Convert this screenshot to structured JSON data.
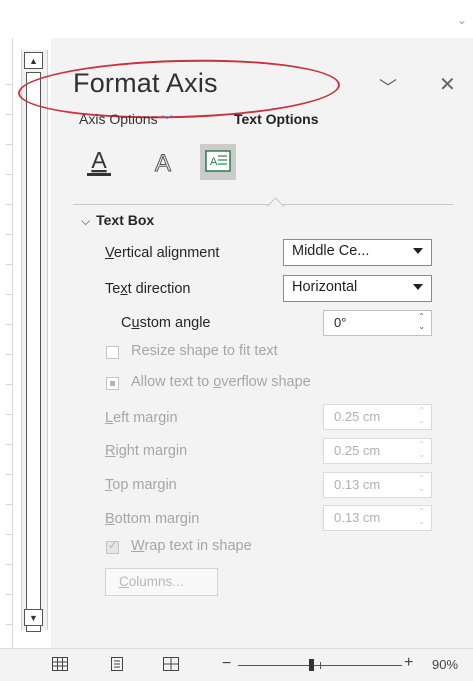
{
  "pane": {
    "title": "Format Axis",
    "collapse_icon": "chevron-down-icon",
    "close_icon": "close-icon",
    "tabs": [
      {
        "label": "Axis Options",
        "selected": false,
        "has_dropdown": true
      },
      {
        "label": "Text Options",
        "selected": true
      }
    ],
    "icon_tabs": [
      {
        "icon": "text-fill-outline-icon",
        "selected": false
      },
      {
        "icon": "text-effects-icon",
        "selected": false
      },
      {
        "icon": "textbox-icon",
        "selected": true
      }
    ],
    "highlight_color": "#c8343c"
  },
  "section": {
    "label": "Text Box",
    "expanded": true
  },
  "fields": {
    "vertical_alignment": {
      "label": "Vertical alignment",
      "value": "Middle Ce..."
    },
    "text_direction": {
      "label": "Text direction",
      "value": "Horizontal"
    },
    "custom_angle": {
      "label": "Custom angle",
      "value": "0°"
    }
  },
  "checkboxes": {
    "resize_shape": {
      "label": "Resize shape to fit text",
      "state": "unchecked",
      "enabled": false
    },
    "allow_overflow": {
      "label": "Allow text to overflow shape",
      "state": "indeterminate",
      "enabled": false
    },
    "wrap_text": {
      "label": "Wrap text in shape",
      "state": "checked",
      "enabled": false
    }
  },
  "margins": {
    "left": {
      "label": "Left margin",
      "value": "0.25 cm"
    },
    "right": {
      "label": "Right margin",
      "value": "0.25 cm"
    },
    "top": {
      "label": "Top margin",
      "value": "0.13 cm"
    },
    "bottom": {
      "label": "Bottom margin",
      "value": "0.13 cm"
    }
  },
  "columns_button": {
    "label": "Columns..."
  },
  "statusbar": {
    "view_icons": [
      "normal-view-icon",
      "page-layout-view-icon",
      "page-break-preview-icon"
    ],
    "zoom_minus": "−",
    "zoom_plus": "+",
    "zoom_percent": "90%"
  }
}
